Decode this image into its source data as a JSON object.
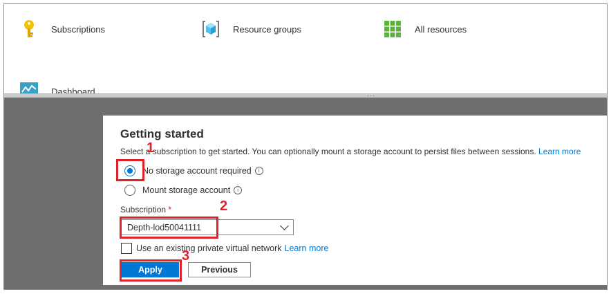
{
  "portal": {
    "services": [
      {
        "label": "Subscriptions",
        "icon": "key-icon"
      },
      {
        "label": "Resource groups",
        "icon": "resource-group-icon"
      },
      {
        "label": "All resources",
        "icon": "grid-icon"
      },
      {
        "label": "Dashboard",
        "icon": "dashboard-icon"
      }
    ],
    "splitter_grip": "..."
  },
  "dialog": {
    "title": "Getting started",
    "description": "Select a subscription to get started. You can optionally mount a storage account to persist files between sessions.",
    "description_link": "Learn more",
    "storage_options": [
      {
        "label": "No storage account required",
        "selected": true
      },
      {
        "label": "Mount storage account",
        "selected": false
      }
    ],
    "subscription_label": "Subscription",
    "required_mark": "*",
    "subscription_value": "Depth-lod50041111",
    "vnet_checkbox_label": "Use an existing private virtual network",
    "vnet_checked": false,
    "vnet_link": "Learn more",
    "apply_label": "Apply",
    "previous_label": "Previous"
  },
  "annotations": {
    "step1": "1",
    "step2": "2",
    "step3": "3",
    "color": "#e0202a"
  },
  "colors": {
    "accent": "#0078d4",
    "overlay": "#6e6e6e"
  }
}
